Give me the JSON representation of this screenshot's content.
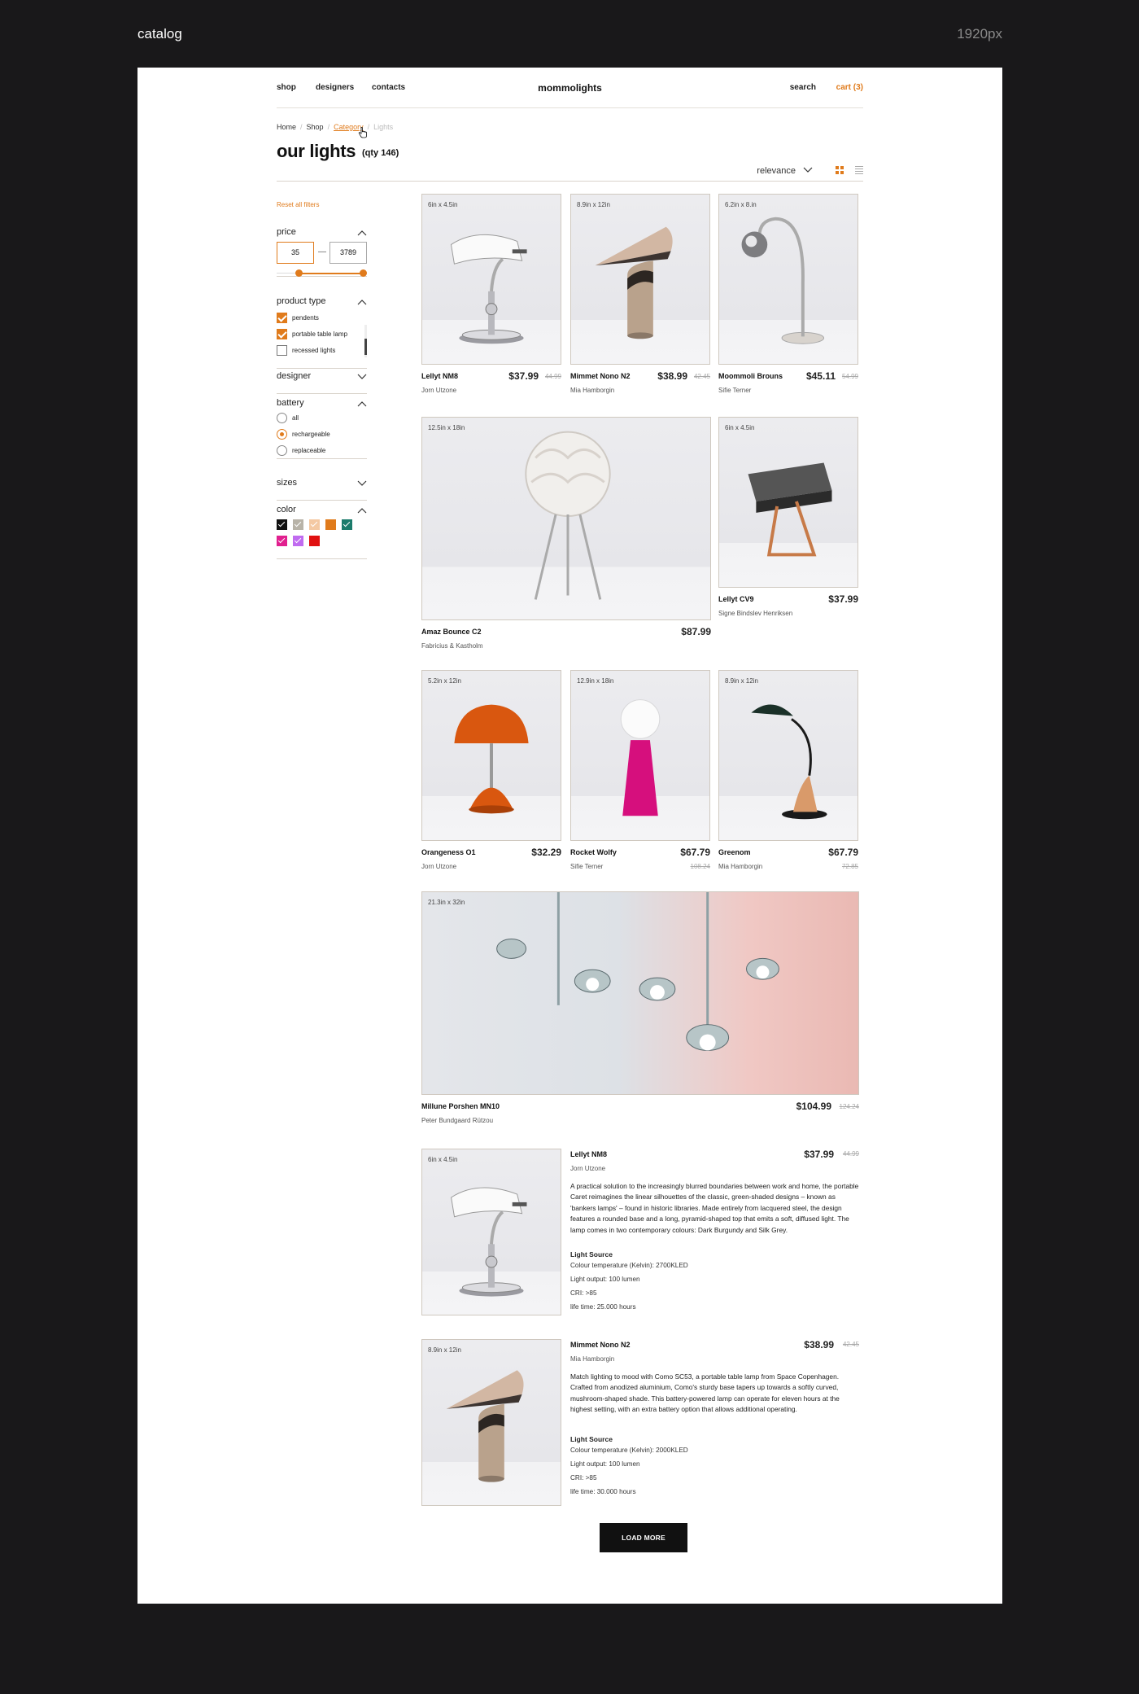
{
  "outer": {
    "title": "catalog",
    "width_label": "1920px"
  },
  "nav": {
    "shop": "shop",
    "designers": "designers",
    "contacts": "contacts",
    "brand": "mommolights",
    "search": "search",
    "cart": "cart (3)"
  },
  "breadcrumb": {
    "items": [
      "Home",
      "Shop",
      "Category",
      "Lights"
    ],
    "sep": "/"
  },
  "page": {
    "title": "our lights",
    "qty": "(qty 146)",
    "sort_label": "relevance",
    "view_mode": "grid"
  },
  "filters": {
    "reset": "Reset all filters",
    "price": {
      "title": "price",
      "min": "35",
      "max": "3789",
      "dash": "—"
    },
    "product_type": {
      "title": "product type",
      "options": [
        {
          "label": "pendents",
          "checked": true
        },
        {
          "label": "portable table lamp",
          "checked": true
        },
        {
          "label": "recessed lights",
          "checked": false
        }
      ]
    },
    "designer": {
      "title": "designer"
    },
    "battery": {
      "title": "battery",
      "options": [
        {
          "label": "all",
          "selected": false
        },
        {
          "label": "rechargeable",
          "selected": true
        },
        {
          "label": "replaceable",
          "selected": false
        }
      ]
    },
    "sizes": {
      "title": "sizes"
    },
    "color": {
      "title": "color",
      "swatches": [
        {
          "color": "#111111",
          "checked": true
        },
        {
          "color": "#b8b3a8",
          "checked": true
        },
        {
          "color": "#f4c9a3",
          "checked": true
        },
        {
          "color": "#e07b1c",
          "checked": false
        },
        {
          "color": "#1b7b6b",
          "checked": true
        },
        {
          "color": "#e1208f",
          "checked": true
        },
        {
          "color": "#c06bf0",
          "checked": true
        },
        {
          "color": "#e01010",
          "checked": false
        }
      ]
    }
  },
  "products": [
    {
      "size": "6in x 4.5in",
      "name": "Lellyt NM8",
      "designer": "Jorn Utzone",
      "price": "$37.99",
      "old_price": "44.99"
    },
    {
      "size": "8.9in x 12in",
      "name": "Mimmet Nono N2",
      "designer": "Mia Hamborgin",
      "price": "$38.99",
      "old_price": "42.45"
    },
    {
      "size": "6.2in x 8.in",
      "name": "Moommoli Brouns",
      "designer": "Sifie Terner",
      "price": "$45.11",
      "old_price": "54.99"
    },
    {
      "size": "12.5in x 18in",
      "name": "Amaz Bounce C2",
      "designer": "Fabricius & Kastholm",
      "price": "$87.99",
      "old_price": ""
    },
    {
      "size": "6in x 4.5in",
      "name": "Lellyt CV9",
      "designer": "Signe Bindslev Henriksen",
      "price": "$37.99",
      "old_price": ""
    },
    {
      "size": "5.2in x 12in",
      "name": "Orangeness O1",
      "designer": "Jorn Utzone",
      "price": "$32.29",
      "old_price": ""
    },
    {
      "size": "12.9in x 18in",
      "name": "Rocket Wolfy",
      "designer": "Sifie Terner",
      "price": "$67.79",
      "old_price": "108.24"
    },
    {
      "size": "8.9in x 12in",
      "name": "Greenom",
      "designer": "Mia Hamborgin",
      "price": "$67.79",
      "old_price": "72.85"
    },
    {
      "size": "21.3in x 32in",
      "name": "Millune Porshen MN10",
      "designer": "Peter Bundgaard Rützou",
      "price": "$104.99",
      "old_price": "124.24"
    }
  ],
  "detail_items": [
    {
      "size": "6in x 4.5in",
      "name": "Lellyt NM8",
      "designer": "Jorn Utzone",
      "price": "$37.99",
      "old_price": "44.99",
      "description": "A practical solution to the increasingly blurred boundaries between work and home, the portable Caret reimagines the linear silhouettes of the classic, green-shaded designs – known as 'bankers lamps' – found in historic libraries. Made entirely from lacquered steel, the design features a rounded base and a long, pyramid-shaped top that emits a soft, diffused light. The lamp comes in two contemporary colours: Dark Burgundy and Silk Grey.",
      "light_source_title": "Light Source",
      "specs": [
        "Colour temperature (Kelvin): 2700KLED",
        "Light output: 100 lumen",
        "CRI: >85",
        "life time: 25.000 hours"
      ]
    },
    {
      "size": "8.9in x 12in",
      "name": "Mimmet Nono N2",
      "designer": "Mia Hamborgin",
      "price": "$38.99",
      "old_price": "42.45",
      "description": "Match lighting to mood with Como SC53, a portable table lamp from Space Copenhagen. Crafted from anodized aluminium, Como's sturdy base tapers up towards a softly curved, mushroom-shaped shade. This battery-powered lamp can operate for eleven hours at the highest setting, with an extra battery option that allows additional operating.",
      "light_source_title": "Light Source",
      "specs": [
        "Colour temperature (Kelvin): 2000KLED",
        "Light output: 100 lumen",
        "CRI: >85",
        "life time: 30.000 hours"
      ]
    }
  ],
  "load_more": "LOAD MORE",
  "colors": {
    "accent": "#e07b1c",
    "background": "#19181a",
    "frame": "#ffffff"
  }
}
